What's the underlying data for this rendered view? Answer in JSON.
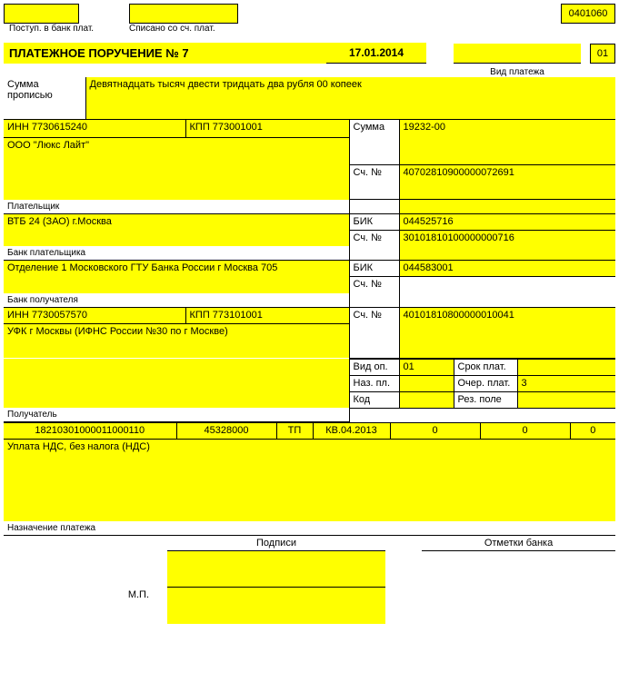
{
  "form_code": "0401060",
  "top_labels": {
    "received": "Поступ. в банк плат.",
    "written_off": "Списано со сч. плат."
  },
  "title": "ПЛАТЕЖНОЕ ПОРУЧЕНИЕ № 7",
  "date": "17.01.2014",
  "code_top": "01",
  "payment_type_label": "Вид платежа",
  "sum_words_label": "Сумма прописью",
  "sum_words": "Девятнадцать тысяч двести тридцать два рубля 00 копеек",
  "payer_inn_label": "ИНН",
  "payer_inn": "7730615240",
  "payer_kpp_label": "КПП",
  "payer_kpp": "773001001",
  "sum_label": "Сумма",
  "sum_value": "19232-00",
  "payer_name": "ООО \"Люкс Лайт\"",
  "acct_label": "Сч. №",
  "payer_acct": "40702810900000072691",
  "payer_label": "Плательщик",
  "payer_bank": "ВТБ 24 (ЗАО) г.Москва",
  "bik_label": "БИК",
  "payer_bik": "044525716",
  "payer_bank_acct": "30101810100000000716",
  "payer_bank_label": "Банк плательщика",
  "recv_bank": "Отделение 1 Московского ГТУ Банка России г Москва 705",
  "recv_bik": "044583001",
  "recv_bank_label": "Банк получателя",
  "recv_inn": "7730057570",
  "recv_kpp": "773101001",
  "recv_acct": "40101810800000010041",
  "recv_name": "УФК г Москвы (ИФНС России №30 по г Москве)",
  "vid_op_label": "Вид оп.",
  "vid_op": "01",
  "srok_label": "Срок плат.",
  "naz_pl_label": "Наз. пл.",
  "ocher_label": "Очер. плат.",
  "ocher": "3",
  "kod_label": "Код",
  "rez_label": "Рез. поле",
  "recv_label": "Получатель",
  "tax_row": {
    "kbk": "18210301000011000110",
    "okato": "45328000",
    "tp": "ТП",
    "period": "КВ.04.2013",
    "z1": "0",
    "z2": "0",
    "z3": "0"
  },
  "purpose": "Уплата НДС, без налога (НДС)",
  "purpose_label": "Назначение платежа",
  "signatures_label": "Подписи",
  "bank_marks_label": "Отметки банка",
  "mp_label": "М.П."
}
